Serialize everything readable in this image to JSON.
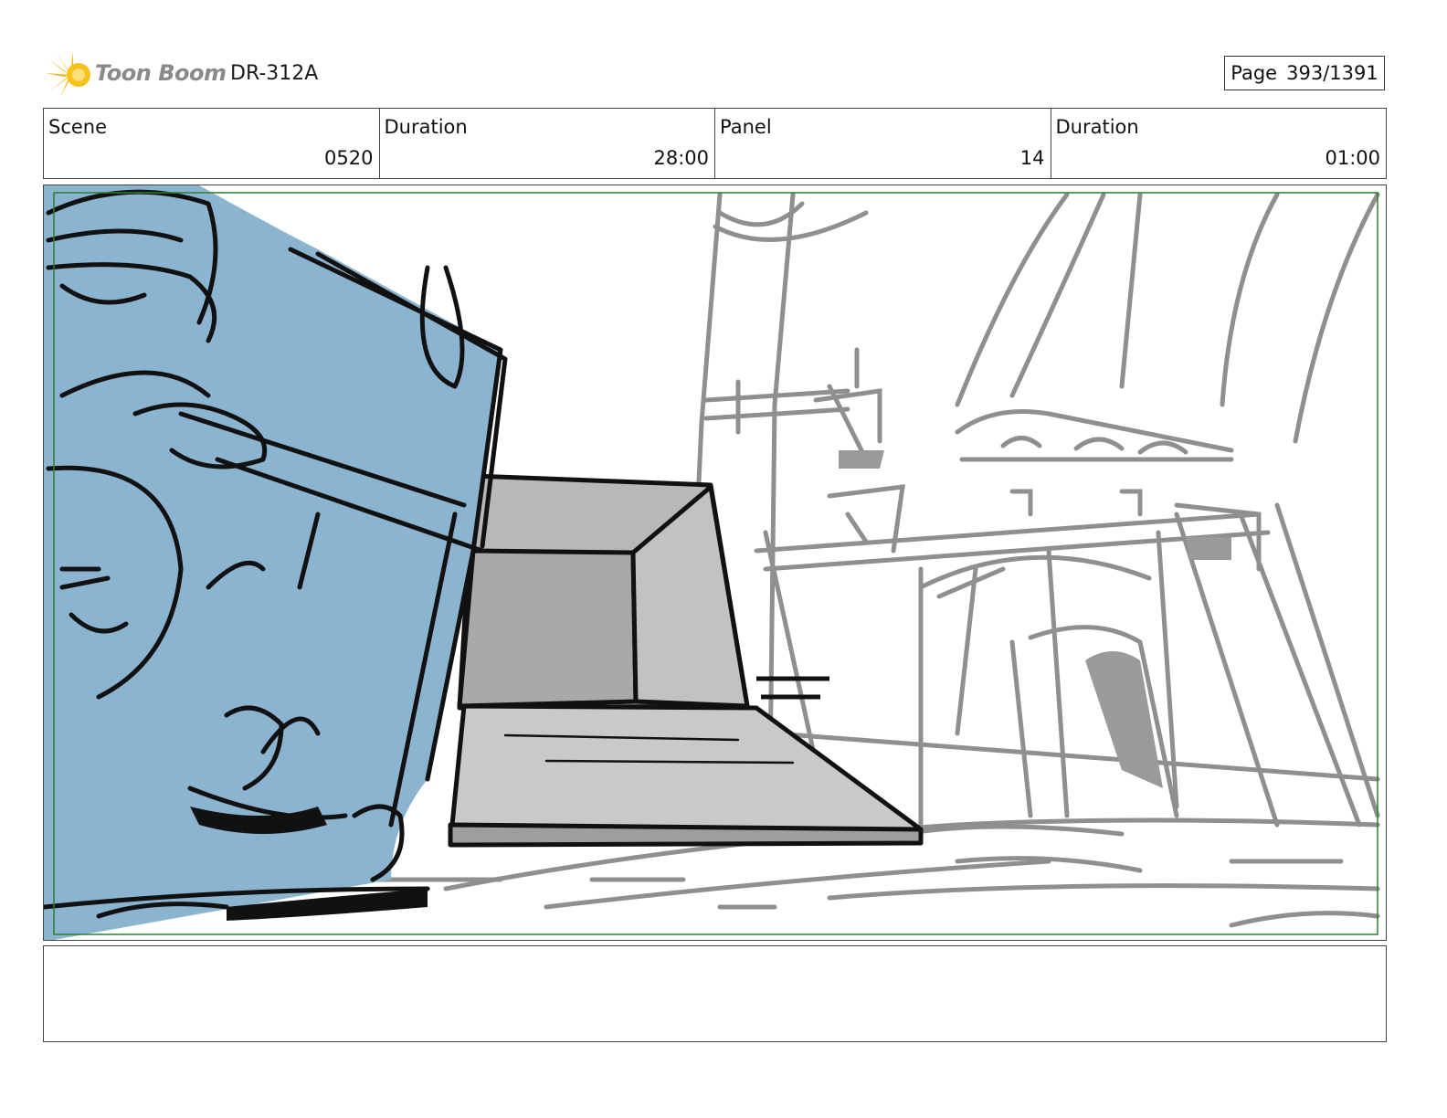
{
  "header": {
    "logo_text": "Toon Boom",
    "production_code": "DR-312A",
    "page_label": "Page",
    "page_value": "393/1391"
  },
  "info": {
    "scene_label": "Scene",
    "scene_value": "0520",
    "scene_duration_label": "Duration",
    "scene_duration_value": "28:00",
    "panel_label": "Panel",
    "panel_value": "14",
    "panel_duration_label": "Duration",
    "panel_duration_value": "01:00"
  },
  "notes": {
    "text": ""
  },
  "colors": {
    "character_fill": "#8ab4d0",
    "prop_fill": "#b5b5b5",
    "background_lines": "#8f8f8f",
    "safe_frame": "#2e7d32"
  }
}
